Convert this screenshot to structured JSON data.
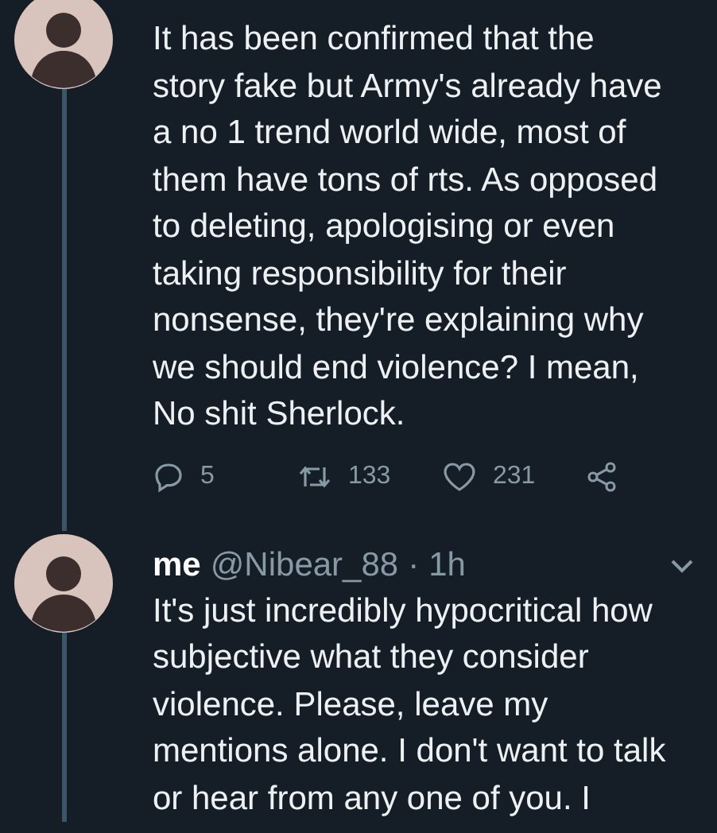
{
  "tweets": [
    {
      "text": "It has been confirmed that the story fake but Army's already have a no 1 trend world wide, most of them have tons of rts. As opposed to deleting, apologising or even taking responsibility for their nonsense, they're explaining why we should end violence? I mean, No shit Sherlock.",
      "thread_continues": true,
      "actions": [
        {
          "kind": "reply",
          "count": "5"
        },
        {
          "kind": "retweet",
          "count": "133"
        },
        {
          "kind": "like",
          "count": "231"
        },
        {
          "kind": "share"
        }
      ]
    },
    {
      "name": "me",
      "handle": "@Nibear_88",
      "separator": "·",
      "time": "1h",
      "text": "It's just incredibly hypocritical how subjective what they consider violence. Please, leave my mentions alone. I don't want to talk or hear from any one of you. I",
      "thread_continues": true
    }
  ]
}
